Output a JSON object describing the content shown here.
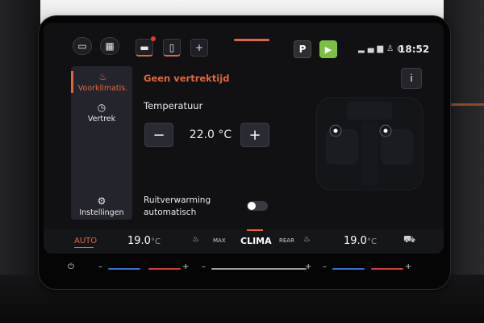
{
  "status": {
    "time": "18:52",
    "plus_label": "+",
    "gear_label": "P",
    "icons": [
      "windows-icon",
      "apps-grid-icon",
      "car-icon",
      "phone-battery-icon",
      "plus-icon",
      "carplay-icon",
      "signal-icon",
      "user-icon",
      "globe-icon"
    ]
  },
  "sidebar": {
    "items": [
      {
        "label": "Voorklimatis.",
        "icon": "heat-waves-icon",
        "active": true
      },
      {
        "label": "Vertrek",
        "icon": "clock-icon",
        "active": false
      },
      {
        "label": "Instellingen",
        "icon": "gear-icon",
        "active": false
      }
    ]
  },
  "main": {
    "title": "Geen vertrektijd",
    "temperature_label": "Temperatuur",
    "temperature_value": "22.0 °C",
    "minus_label": "−",
    "plus_label": "+",
    "rear_window_label_line1": "Ruitverwarming",
    "rear_window_label_line2": "automatisch",
    "rear_window_on": false,
    "info_icon": "i"
  },
  "climate_bar": {
    "auto_label": "AUTO",
    "left_temp": "19.0",
    "right_temp": "19.0",
    "unit": "°C",
    "clima_label": "CLIMA",
    "max_label": "MAX",
    "rear_label": "REAR"
  },
  "strip": {
    "minus_label": "–",
    "plus_label": "+",
    "power_icon": "⏻"
  },
  "colors": {
    "accent": "#e2643e",
    "carplay": "#7bc043",
    "background": "#111114"
  }
}
